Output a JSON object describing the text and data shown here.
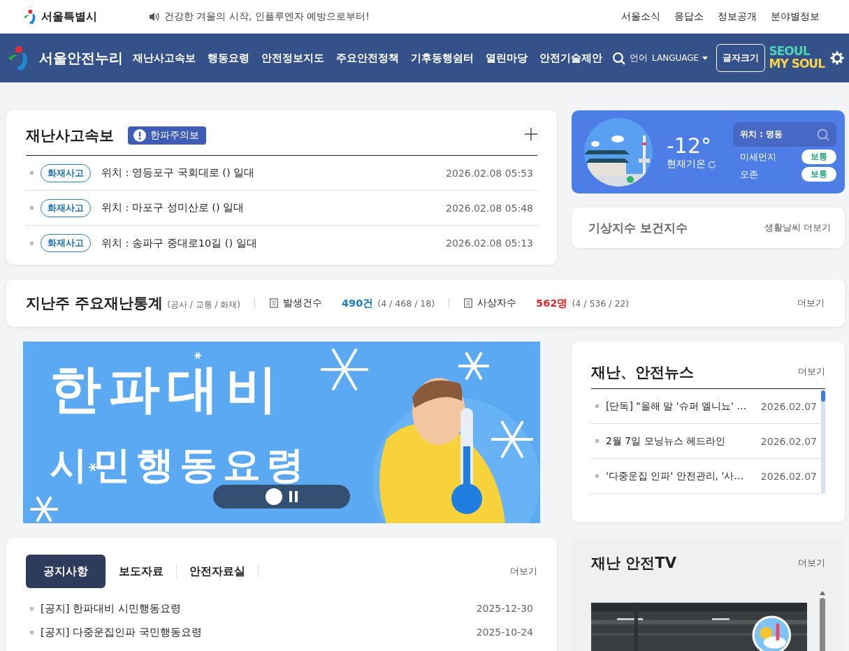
{
  "top_bar": {
    "logo": "서울특별시",
    "notice": "건강한 겨울의 시작, 인플루엔자 예방으로부터!",
    "links": [
      "서울소식",
      "응답소",
      "정보공개",
      "분야별정보"
    ]
  },
  "nav": {
    "site_name": "서울안전누리",
    "menu": [
      "재난사고속보",
      "행동요령",
      "안전정보지도",
      "주요안전정책",
      "기후동행쉼터",
      "열린마당",
      "안전기술제안"
    ],
    "language_label": "언어",
    "language_select": "LANGUAGE",
    "font_size_button": "글자크기",
    "slogan": [
      "SEOUL",
      "MY SOUL"
    ]
  },
  "disaster_alerts": {
    "title": "재난사고속보",
    "badge": "한파주의보",
    "items": [
      {
        "tag": "화재사고",
        "text": "위치 : 영등포구 국회대로 () 일대",
        "time": "2026.02.08 05:53"
      },
      {
        "tag": "화재사고",
        "text": "위치 : 마포구 성미산로 () 일대",
        "time": "2026.02.08 05:48"
      },
      {
        "tag": "화재사고",
        "text": "위치 : 송파구 중대로10길 () 일대",
        "time": "2026.02.08 05:13"
      }
    ]
  },
  "weather": {
    "temperature": "-12°",
    "label": "현재기온",
    "location": "위치 : 명동",
    "indices": [
      {
        "name": "미세먼지",
        "value": "보통"
      },
      {
        "name": "오존",
        "value": "보통"
      }
    ]
  },
  "life_index": {
    "title": "기상지수 보건지수",
    "more": "생활날씨 더보기"
  },
  "weekly_stats": {
    "title": "지난주 주요재난통계",
    "subtitle": "(공사 / 교통 / 화재)",
    "more": "더보기",
    "stats": [
      {
        "label": "발생건수",
        "value": "490건",
        "breakdown": "(4 / 468 / 18)",
        "color": "#1b7cc4"
      },
      {
        "label": "사상자수",
        "value": "562명",
        "breakdown": "(4 / 536 / 22)",
        "color": "#e02a2a"
      }
    ]
  },
  "banner": {
    "title": "한파대비",
    "subtitle": "시민행동요령",
    "slides": [
      {
        "selected": true
      }
    ]
  },
  "news": {
    "title": "재난、안전뉴스",
    "more": "더보기",
    "items": [
      {
        "text": "[단독] \"올해 말 '슈퍼 엘니뇨' …",
        "date": "2026.02.07"
      },
      {
        "text": "2월 7일 모닝뉴스 헤드라인",
        "date": "2026.02.07"
      },
      {
        "text": "'다중운집 인파' 안전관리, '사…",
        "date": "2026.02.07"
      }
    ]
  },
  "notices": {
    "more": "더보기",
    "tabs": [
      {
        "label": "공지사항",
        "selected": true
      },
      {
        "label": "보도자료",
        "selected": false
      },
      {
        "label": "안전자료실",
        "selected": false
      }
    ],
    "items": [
      {
        "text": "[공지] 한파대비 시민행동요령",
        "date": "2025-12-30"
      },
      {
        "text": "[공지] 다중운집인파 국민행동요령",
        "date": "2025-10-24"
      }
    ]
  },
  "safety_tv": {
    "title": "재난 안전TV",
    "more": "더보기"
  }
}
